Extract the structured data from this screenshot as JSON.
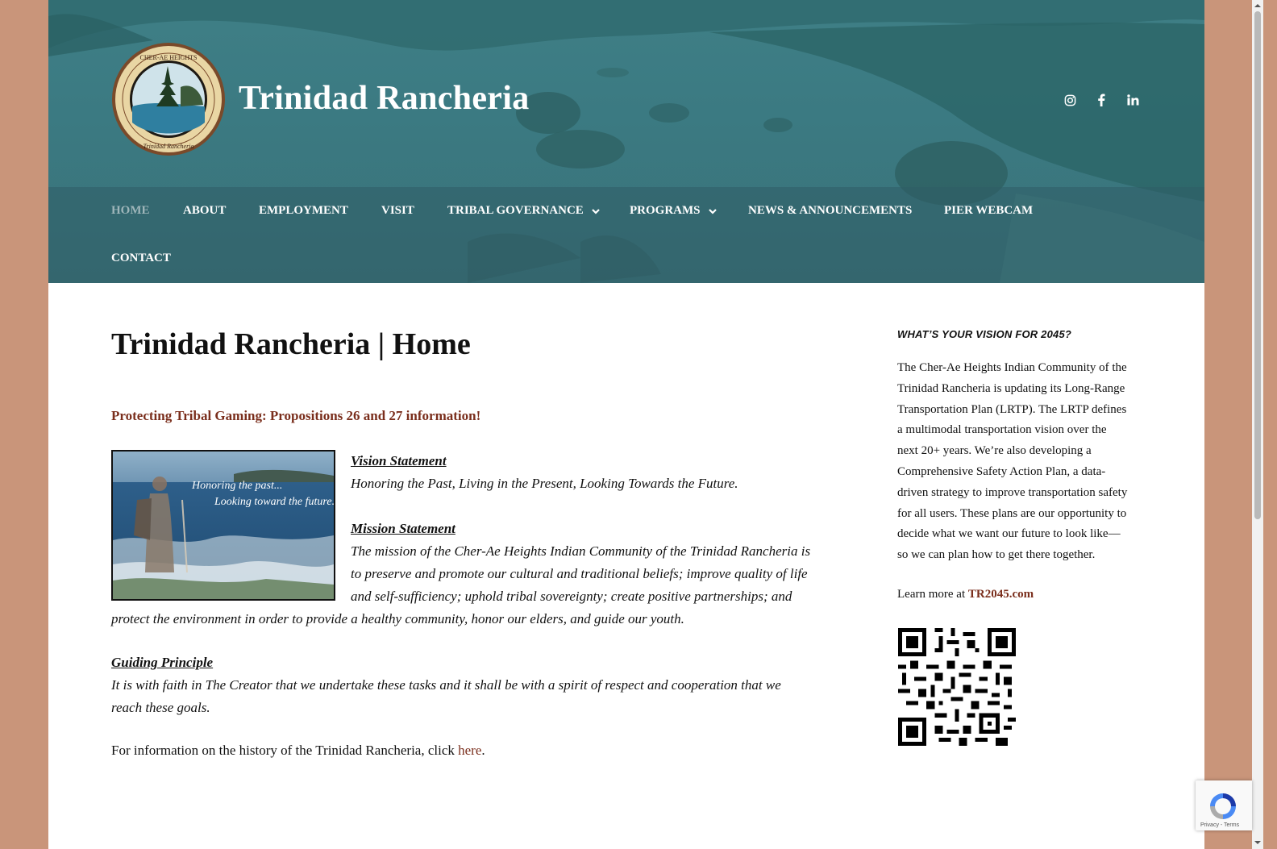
{
  "site": {
    "title": "Trinidad Rancheria",
    "logo_text": "CHER-AE HEIGHTS INDIAN COMMUNITY of the Trinidad Rancheria"
  },
  "social": [
    "instagram-icon",
    "facebook-icon",
    "linkedin-icon"
  ],
  "nav": {
    "items": [
      {
        "label": "Home",
        "active": true
      },
      {
        "label": "About"
      },
      {
        "label": "Employment"
      },
      {
        "label": "Visit"
      },
      {
        "label": "Tribal Governance",
        "dropdown": true
      },
      {
        "label": "Programs",
        "dropdown": true
      },
      {
        "label": "News & Announcements"
      },
      {
        "label": "Pier Webcam"
      },
      {
        "label": "Contact"
      }
    ]
  },
  "main": {
    "title": "Trinidad Rancheria | Home",
    "promo_link": "Protecting Tribal Gaming: Propositions 26 and 27 information!",
    "image_caption": [
      "Honoring the past...",
      "Looking toward the future."
    ],
    "vision_heading": "Vision Statement",
    "vision_text": "Honoring the Past, Living in the Present, Looking Towards the Future.",
    "mission_heading": "Mission Statement",
    "mission_lines": [
      "The mission of the Cher-Ae Heights Indian Community of the Trinidad Rancheria is",
      "to preserve and promote our cultural and traditional beliefs; improve quality of life",
      "and self-sufficiency; uphold tribal sovereignty; create positive partnerships; and",
      "protect the environment in order to provide a healthy community, honor our elders, and guide our youth."
    ],
    "guiding_heading": "Guiding Principle",
    "guiding_lines": [
      "It is with faith in The Creator that we undertake these tasks and it shall be with a spirit of respect and cooperation that we",
      "reach these goals."
    ],
    "history_text": "For information on the history of the Trinidad Rancheria, click ",
    "history_link": "here",
    "history_end": "."
  },
  "sidebar": {
    "heading": "WHAT’S YOUR VISION FOR 2045?",
    "body_lines": [
      "The Cher-Ae Heights Indian Community of the",
      "Trinidad Rancheria is updating its Long-Range",
      "Transportation Plan (LRTP). The LRTP defines",
      "a multimodal transportation vision over the",
      "next 20+ years. We’re also developing a",
      "Comprehensive Safety Action Plan, a data-",
      "driven strategy to improve transportation safety",
      "for all users. These plans are our opportunity to",
      "decide what we want our future to look like—",
      "so we can plan how to get there together."
    ],
    "learn_text": "Learn more at ",
    "learn_link": "TR2045.com"
  },
  "recaptcha": {
    "links": "Privacy - Terms"
  }
}
